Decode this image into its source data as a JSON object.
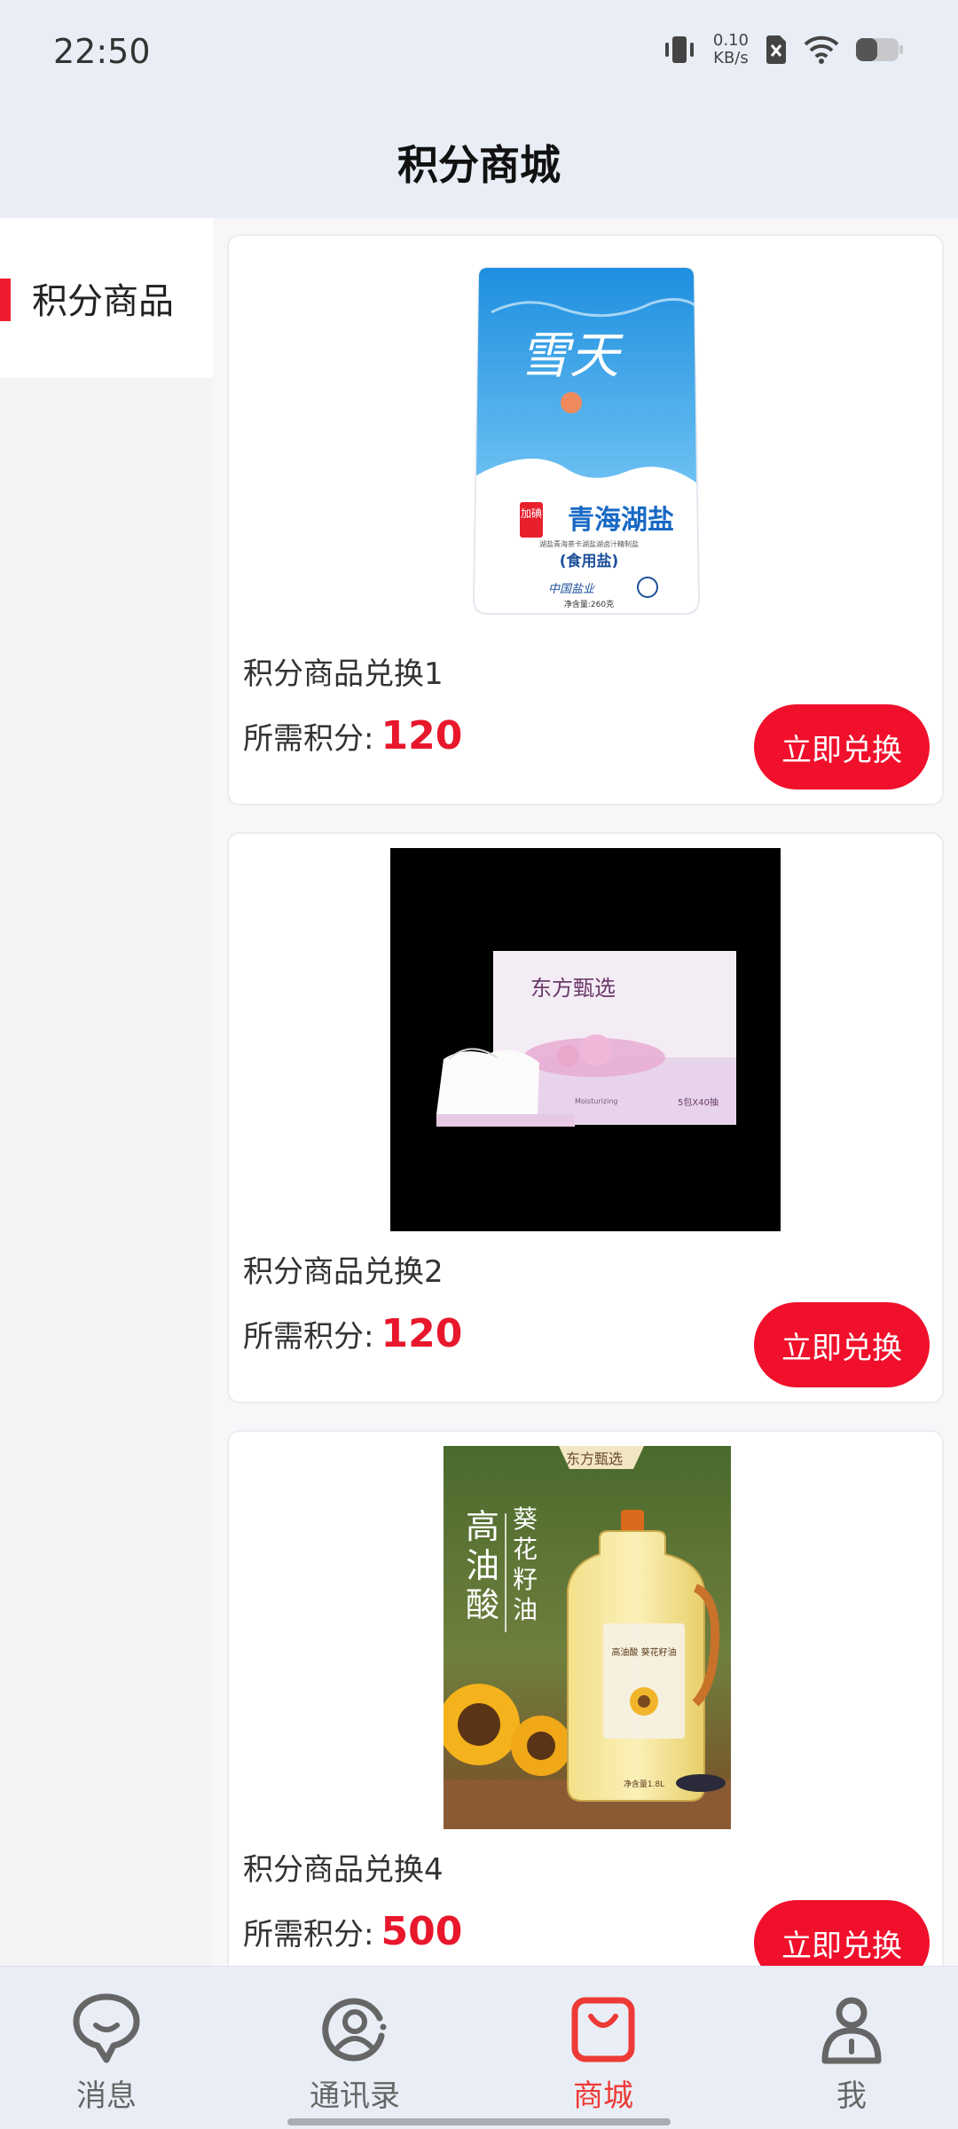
{
  "status_bar": {
    "time": "22:50",
    "net_speed_value": "0.10",
    "net_speed_unit": "KB/s",
    "icons": [
      "vibrate-icon",
      "no-sim-icon",
      "wifi-icon",
      "battery-icon"
    ]
  },
  "header": {
    "title": "积分商城"
  },
  "sidebar": {
    "items": [
      {
        "label": "积分商品",
        "active": true
      }
    ]
  },
  "products": [
    {
      "name": "积分商品兑换1",
      "points_label": "所需积分:",
      "points": "120",
      "button": "立即兑换",
      "image": {
        "brand": "雪天",
        "badge": "加碘",
        "product": "青海湖盐",
        "sub": "(食用盐)",
        "fine_print": "湖盐青海茶卡湖盐湖卤汁精制盐",
        "slogan": "中国盐业",
        "net": "净含量:260克"
      }
    },
    {
      "name": "积分商品兑换2",
      "points_label": "所需积分:",
      "points": "120",
      "button": "立即兑换",
      "image": {
        "brand": "东方甄选",
        "product": "Moisturizing",
        "pack": "5包X40抽"
      }
    },
    {
      "name": "积分商品兑换4",
      "points_label": "所需积分:",
      "points": "500",
      "button": "立即兑换",
      "image": {
        "brand": "东方甄选",
        "big1": "高",
        "big2": "油",
        "big3": "酸",
        "name1": "葵",
        "name2": "花",
        "name3": "籽",
        "name4": "油",
        "bottle_label": "高油酸 葵花籽油",
        "net": "净含量1.8L"
      }
    }
  ],
  "bottom_nav": {
    "items": [
      {
        "label": "消息",
        "icon": "chat-bubble-icon",
        "active": false
      },
      {
        "label": "通讯录",
        "icon": "contacts-icon",
        "active": false
      },
      {
        "label": "商城",
        "icon": "shopping-bag-icon",
        "active": true
      },
      {
        "label": "我",
        "icon": "person-icon",
        "active": false
      }
    ]
  },
  "colors": {
    "accent": "#ee1c2e",
    "button": "#f0102b",
    "header_bg": "#e9eef6",
    "active_tab": "#ee3a36"
  }
}
